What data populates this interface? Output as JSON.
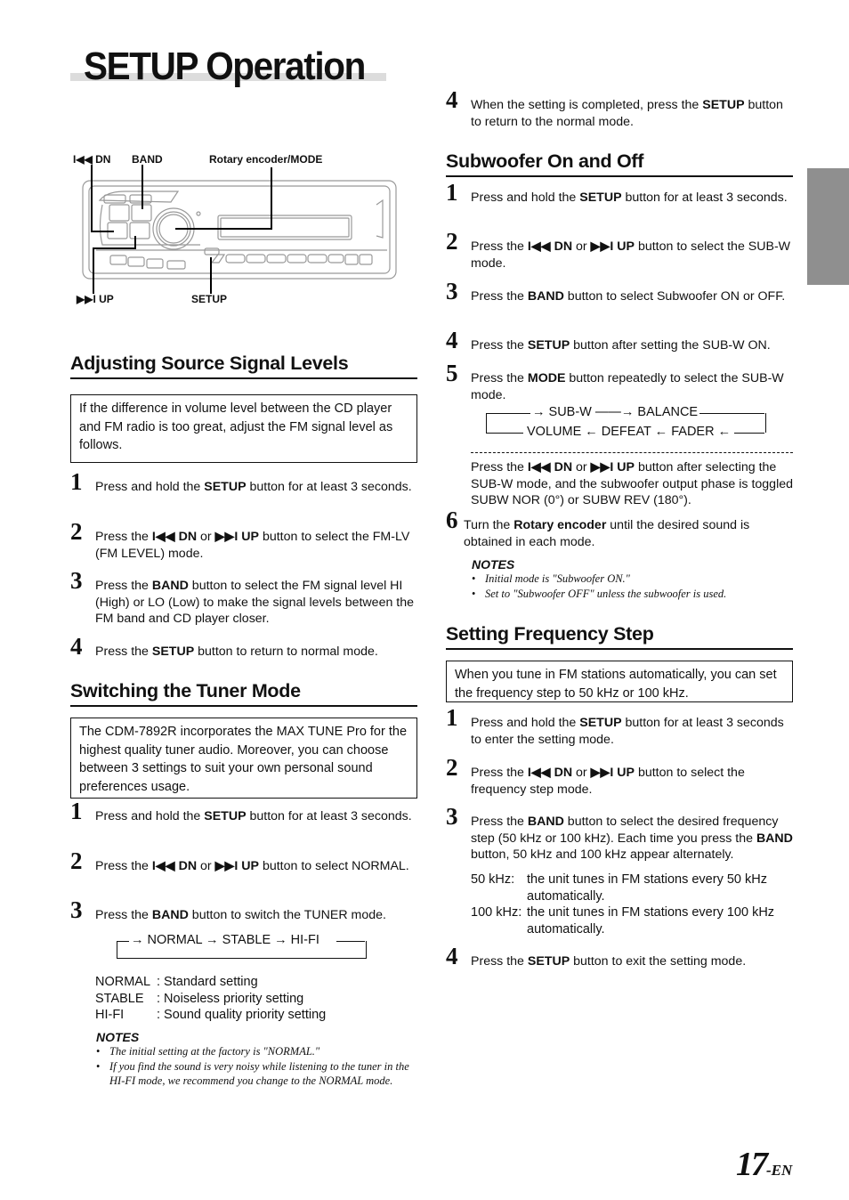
{
  "page": {
    "title": "SETUP Operation",
    "page_number": "17",
    "page_suffix": "-EN"
  },
  "diagram": {
    "labels": {
      "dn": "◀◀ DN",
      "band": "BAND",
      "rotary": "Rotary encoder/MODE",
      "up": "▶▶I UP",
      "setup": "SETUP"
    }
  },
  "adjusting": {
    "heading": "Adjusting Source Signal Levels",
    "intro": "If the difference in volume level between the CD player and FM radio is too great, adjust the FM signal level as follows.",
    "steps": [
      {
        "num": "1",
        "pre": "Press and hold the ",
        "bold": "SETUP",
        "post": " button for at least 3 seconds."
      },
      {
        "num": "2",
        "pre": "Press the ",
        "bold": "I◀◀ DN",
        "mid": " or ",
        "bold2": "▶▶I UP",
        "post": " button to select the FM-LV (FM LEVEL) mode."
      },
      {
        "num": "3",
        "pre": "Press the ",
        "bold": "BAND",
        "post": " button to select the FM signal level HI (High) or LO (Low) to make the signal levels between the FM band and CD player closer."
      },
      {
        "num": "4",
        "pre": "Press the ",
        "bold": "SETUP",
        "post": " button to return to normal mode."
      }
    ]
  },
  "tuner": {
    "heading": "Switching the Tuner Mode",
    "intro": "The CDM-7892R incorporates the MAX TUNE Pro for the highest quality tuner audio. Moreover, you can choose between 3 settings to suit your own personal sound preferences usage.",
    "steps": [
      {
        "num": "1",
        "pre": "Press and hold the ",
        "bold": "SETUP",
        "post": " button for at least 3 seconds."
      },
      {
        "num": "2",
        "pre": "Press the ",
        "bold": "I◀◀ DN",
        "mid": " or ",
        "bold2": "▶▶I UP",
        "post": " button to select NORMAL."
      },
      {
        "num": "3",
        "pre": "Press the ",
        "bold": "BAND",
        "post": " button to switch the TUNER mode."
      }
    ],
    "flow": "→ NORMAL → STABLE → HI-FI",
    "definitions": [
      {
        "term": "NORMAL",
        "desc": ": Standard setting"
      },
      {
        "term": "STABLE",
        "desc": ": Noiseless priority setting"
      },
      {
        "term": "HI-FI",
        "desc": ": Sound quality priority setting"
      }
    ],
    "notes_heading": "NOTES",
    "notes": [
      "The initial setting at the factory is \"NORMAL.\"",
      "If you find the sound is very noisy while listening to the tuner in the HI-FI mode, we recommend you change to the NORMAL mode."
    ]
  },
  "right_top_step": {
    "num": "4",
    "pre": "When the setting is completed, press the ",
    "bold": "SETUP",
    "post": " button to return to the normal mode."
  },
  "subwoofer": {
    "heading": "Subwoofer On and Off",
    "steps": [
      {
        "num": "1",
        "pre": "Press and hold the ",
        "bold": "SETUP",
        "post": " button for at least 3 seconds."
      },
      {
        "num": "2",
        "pre": "Press the ",
        "bold": "I◀◀ DN",
        "mid": " or ",
        "bold2": "▶▶I UP",
        "post": " button to select the SUB-W mode."
      },
      {
        "num": "3",
        "pre": "Press the ",
        "bold": "BAND",
        "post": " button to select Subwoofer ON or OFF."
      },
      {
        "num": "4",
        "pre": "Press the ",
        "bold": "SETUP",
        "post": " button after setting the SUB-W ON."
      },
      {
        "num": "5",
        "pre": "Press the ",
        "bold": "MODE",
        "post": " button repeatedly to select the SUB-W mode."
      }
    ],
    "flow_top": "→ SUB-W ——→ BALANCE",
    "flow_bottom": "VOLUME ← DEFEAT ← FADER ←",
    "phase_pre": "Press the ",
    "phase_bold": "I◀◀ DN",
    "phase_mid": " or ",
    "phase_bold2": "▶▶I UP",
    "phase_post": " button after selecting the SUB-W mode, and the subwoofer output phase is toggled  SUBW NOR (0°) or SUBW REV (180°).",
    "step6": {
      "num": "6",
      "pre": "Turn the ",
      "bold": "Rotary encoder",
      "post": " until the desired sound is obtained in each mode."
    },
    "notes_heading": "NOTES",
    "notes": [
      "Initial mode is \"Subwoofer ON.\"",
      "Set to \"Subwoofer OFF\" unless the subwoofer is used."
    ]
  },
  "freq": {
    "heading": "Setting Frequency Step",
    "intro": "When you tune in FM stations automatically, you can set the frequency step to 50 kHz or 100 kHz.",
    "steps": [
      {
        "num": "1",
        "pre": "Press and hold the ",
        "bold": "SETUP",
        "post": " button for at least 3 seconds to enter the setting mode."
      },
      {
        "num": "2",
        "pre": "Press the ",
        "bold": "I◀◀ DN",
        "mid": " or ",
        "bold2": "▶▶I UP",
        "post": " button to select the frequency step mode."
      },
      {
        "num": "3",
        "pre": "Press the ",
        "bold": "BAND",
        "post": " button to select the desired frequency step (50 kHz or 100 kHz). Each time you press the ",
        "bold2": "BAND",
        "post2": " button, 50 kHz and 100 kHz appear alternately."
      },
      {
        "num": "4",
        "pre": "Press the ",
        "bold": "SETUP",
        "post": " button to exit the setting mode."
      }
    ],
    "definitions": [
      {
        "term": "50 kHz:",
        "desc": "the unit tunes in FM stations every 50 kHz automatically."
      },
      {
        "term": "100 kHz:",
        "desc": "the unit tunes in FM stations every 100 kHz automatically."
      }
    ]
  }
}
